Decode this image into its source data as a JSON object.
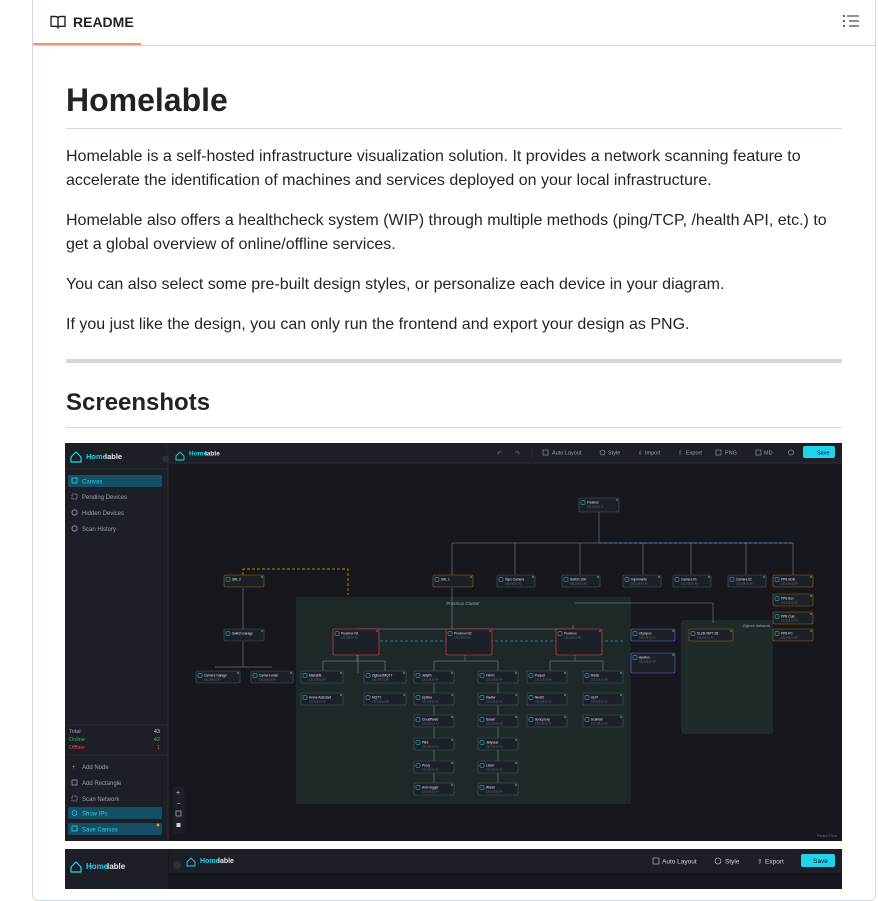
{
  "readme": {
    "tab_label": "README",
    "title": "Homelable",
    "paragraphs": [
      "Homelable is a self-hosted infrastructure visualization solution. It provides a network scanning feature to accelerate the identification of machines and services deployed on your local infrastructure.",
      "Homelable also offers a healthcheck system (WIP) through multiple methods (ping/TCP, /health API, etc.) to get a global overview of online/offline services.",
      "You can also select some pre-built design styles, or personalize each device in your diagram.",
      "If you just like the design, you can only run the frontend and export your design as PNG."
    ],
    "screenshots_heading": "Screenshots"
  },
  "app": {
    "brand_left": "Home",
    "brand_right": "lable",
    "nav": [
      "Canvas",
      "Pending Devices",
      "Hidden Devices",
      "Scan History"
    ],
    "stats": {
      "total_label": "Total",
      "total": "43",
      "online_label": "Online",
      "online": "42",
      "offline_label": "Offline",
      "offline": "1"
    },
    "actions": [
      "Add Node",
      "Add Rectangle",
      "Scan Network",
      "Show IPs",
      "Save Canvas"
    ],
    "toolbar": [
      "Auto Layout",
      "Style",
      "Import",
      "Export",
      "PNG",
      "MD"
    ],
    "save": "Save",
    "toolbar2": [
      "Auto Layout",
      "Style",
      "Export"
    ],
    "watermark": "React Flow",
    "cluster_label": "Proxmox Cluster",
    "zigbee_label": "Zigbee network",
    "colors": {
      "accent": "#22d3ee",
      "online": "#22c55e",
      "offline": "#ef4444",
      "bg": "#16181d"
    }
  },
  "nodes": [
    {
      "label": "Freebox",
      "ip": "192.168.10.10"
    },
    {
      "label": "SRL 2"
    },
    {
      "label": "SRL 1"
    },
    {
      "label": "Tapo Camera",
      "ip": "192.168.10.40"
    },
    {
      "label": "Switch 1Gb",
      "ip": "192.168.10.40"
    },
    {
      "label": "Imprimante",
      "ip": "192.168.10.40"
    },
    {
      "label": "Camera 01",
      "ip": "192.168.10.40"
    },
    {
      "label": "Camera 02",
      "ip": "192.168.10.40"
    },
    {
      "label": "PPB SDB",
      "ip": "192.168.10.40"
    },
    {
      "label": "PPB Box",
      "ip": "192.168.10.40"
    },
    {
      "label": "PPB Cuis",
      "ip": "192.168.10.40"
    },
    {
      "label": "PPB PC",
      "ip": "192.168.10.40"
    },
    {
      "label": "Switch Garage"
    },
    {
      "label": "Camera Garage",
      "ip": "192.168.10.40"
    },
    {
      "label": "Camera exter",
      "ip": "192.168.10.40"
    },
    {
      "label": "Proxmox N1",
      "ip": "192.168.10.40"
    },
    {
      "label": "Proxmox N2",
      "ip": "192.168.10.40"
    },
    {
      "label": "Proxmox",
      "ip": "192.168.10.40"
    },
    {
      "label": "Olympus",
      "ip": "192.168.10.40"
    },
    {
      "label": "Apollon",
      "ip": "192.168.10.40"
    },
    {
      "label": "SLZB-06P7 ZB",
      "ip": "192.168.10.40"
    },
    {
      "label": "MariaDB",
      "ip": "192.168.10.40"
    },
    {
      "label": "Zigbee2MQTT",
      "ip": "192.168.10.40"
    },
    {
      "label": "Jellyfin",
      "ip": "192.168.10.40"
    },
    {
      "label": "Filmin",
      "ip": "192.168.10.40"
    },
    {
      "label": "Paquet",
      "ip": "192.168.10.40"
    },
    {
      "label": "Radio",
      "ip": "192.168.10.40"
    },
    {
      "label": "Home Assistant",
      "ip": "192.168.10.40"
    },
    {
      "label": "MQTT",
      "ip": "192.168.10.40"
    },
    {
      "label": "Uptime",
      "ip": "192.168.10.40"
    },
    {
      "label": "Vaultw",
      "ip": "192.168.10.40"
    },
    {
      "label": "Nextcl",
      "ip": "192.168.10.40"
    },
    {
      "label": "GLPI",
      "ip": "192.168.10.40"
    },
    {
      "label": "Cloudflared",
      "ip": "192.168.10.40"
    },
    {
      "label": "Sonarr",
      "ip": "192.168.10.40"
    },
    {
      "label": "Syncproxy",
      "ip": "192.168.10.40"
    },
    {
      "label": "Scanlab",
      "ip": "192.168.10.40"
    },
    {
      "label": "PBS",
      "ip": "192.168.10.40"
    },
    {
      "label": "Jellyseer",
      "ip": "192.168.10.40"
    },
    {
      "label": "Proxy",
      "ip": "192.168.10.40"
    },
    {
      "label": "Lidarr",
      "ip": "192.168.10.40"
    },
    {
      "label": "Auto-logger",
      "ip": "192.168.10.40"
    },
    {
      "label": "Wizarr",
      "ip": "192.168.10.40"
    }
  ]
}
